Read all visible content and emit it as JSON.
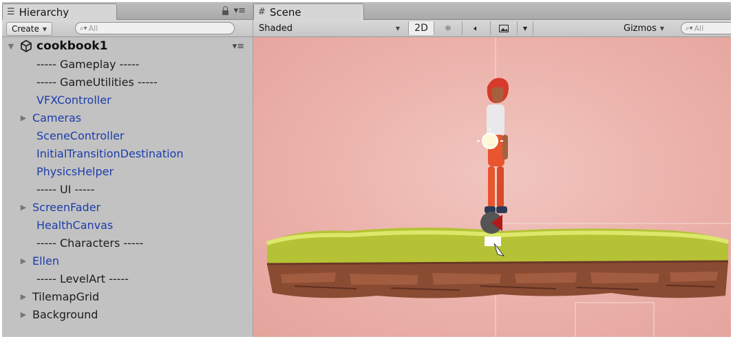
{
  "hierarchy": {
    "tab_label": "Hierarchy",
    "create_label": "Create",
    "search_placeholder": "All",
    "root_label": "cookbook1",
    "items": [
      {
        "label": "----- Gameplay -----",
        "prefab": false,
        "expandable": false
      },
      {
        "label": "----- GameUtilities -----",
        "prefab": false,
        "expandable": false
      },
      {
        "label": "VFXController",
        "prefab": true,
        "expandable": false
      },
      {
        "label": "Cameras",
        "prefab": true,
        "expandable": true
      },
      {
        "label": "SceneController",
        "prefab": true,
        "expandable": false
      },
      {
        "label": "InitialTransitionDestination",
        "prefab": true,
        "expandable": false
      },
      {
        "label": "PhysicsHelper",
        "prefab": true,
        "expandable": false
      },
      {
        "label": "----- UI -----",
        "prefab": false,
        "expandable": false
      },
      {
        "label": "ScreenFader",
        "prefab": true,
        "expandable": true
      },
      {
        "label": "HealthCanvas",
        "prefab": true,
        "expandable": false
      },
      {
        "label": "----- Characters -----",
        "prefab": false,
        "expandable": false
      },
      {
        "label": "Ellen",
        "prefab": true,
        "expandable": true
      },
      {
        "label": "----- LevelArt -----",
        "prefab": false,
        "expandable": false
      },
      {
        "label": "TilemapGrid",
        "prefab": false,
        "expandable": true
      },
      {
        "label": "Background",
        "prefab": false,
        "expandable": true
      }
    ]
  },
  "scene": {
    "tab_label": "Scene",
    "shading_mode": "Shaded",
    "mode_2d": "2D",
    "gizmos_label": "Gizmos",
    "search_placeholder": "All"
  },
  "colors": {
    "prefab_text": "#1c3da9",
    "viewport_bg": "#ebb1aa"
  }
}
